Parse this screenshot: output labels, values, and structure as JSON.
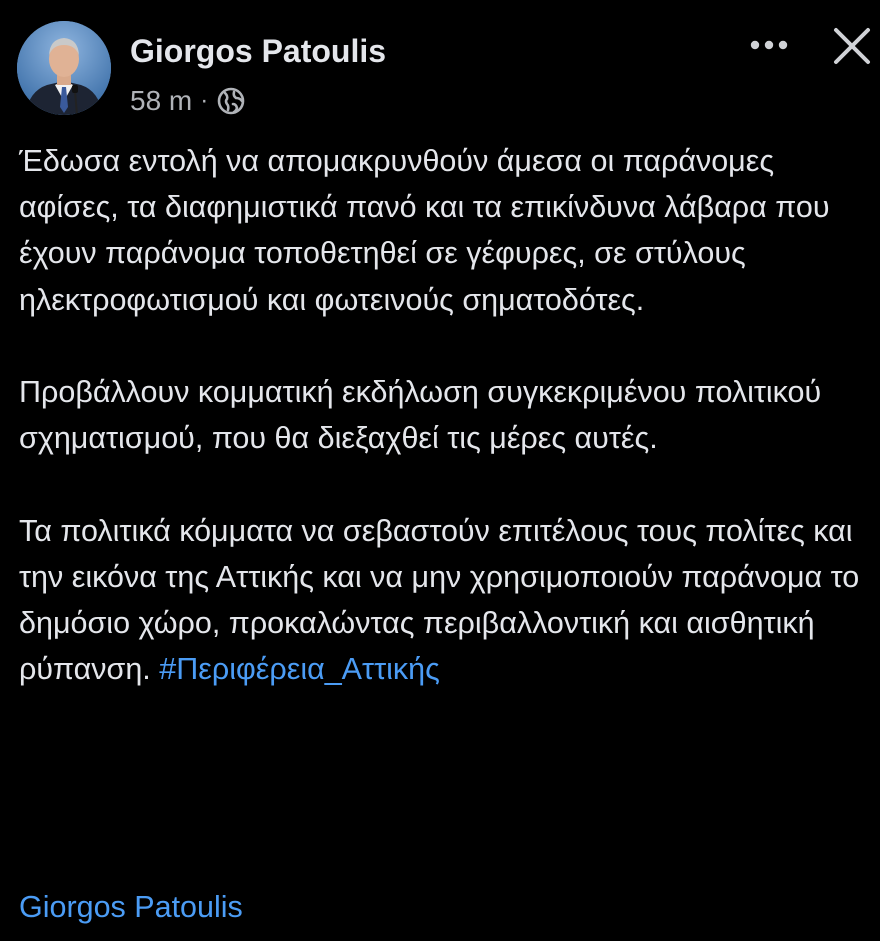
{
  "header": {
    "author_name": "Giorgos Patoulis",
    "timestamp": "58 m",
    "separator": "·",
    "privacy_icon": "globe-icon",
    "more_icon": "more-horizontal-icon",
    "close_icon": "close-icon"
  },
  "post": {
    "paragraphs": [
      "Έδωσα εντολή να απομακρυνθούν άμεσα οι παράνομες αφίσες, τα διαφημιστικά πανό και τα επικίνδυνα λάβαρα που έχουν παράνομα τοποθετηθεί σε γέφυρες, σε στύλους ηλεκτροφωτισμού και φωτεινούς σηματοδότες.",
      "Προβάλλουν κομματική εκδήλωση συγκεκριμένου πολιτικού σχηματισμού, που θα διεξαχθεί τις μέρες αυτές."
    ],
    "last_paragraph_text": "Τα πολιτικά κόμματα να σεβαστούν επιτέλους τους πολίτες και την εικόνα της Αττικής και να μην χρησιμοποιούν παράνομα το δημόσιο χώρο, προκαλώντας περιβαλλοντική και αισθητική ρύπανση.",
    "hashtag": "#Περιφέρεια_Αττικής",
    "author_link": "Giorgos Patoulis"
  },
  "colors": {
    "background": "#000000",
    "text": "#e4e6eb",
    "secondary_text": "#b0b3b8",
    "link": "#4b9cf5"
  }
}
